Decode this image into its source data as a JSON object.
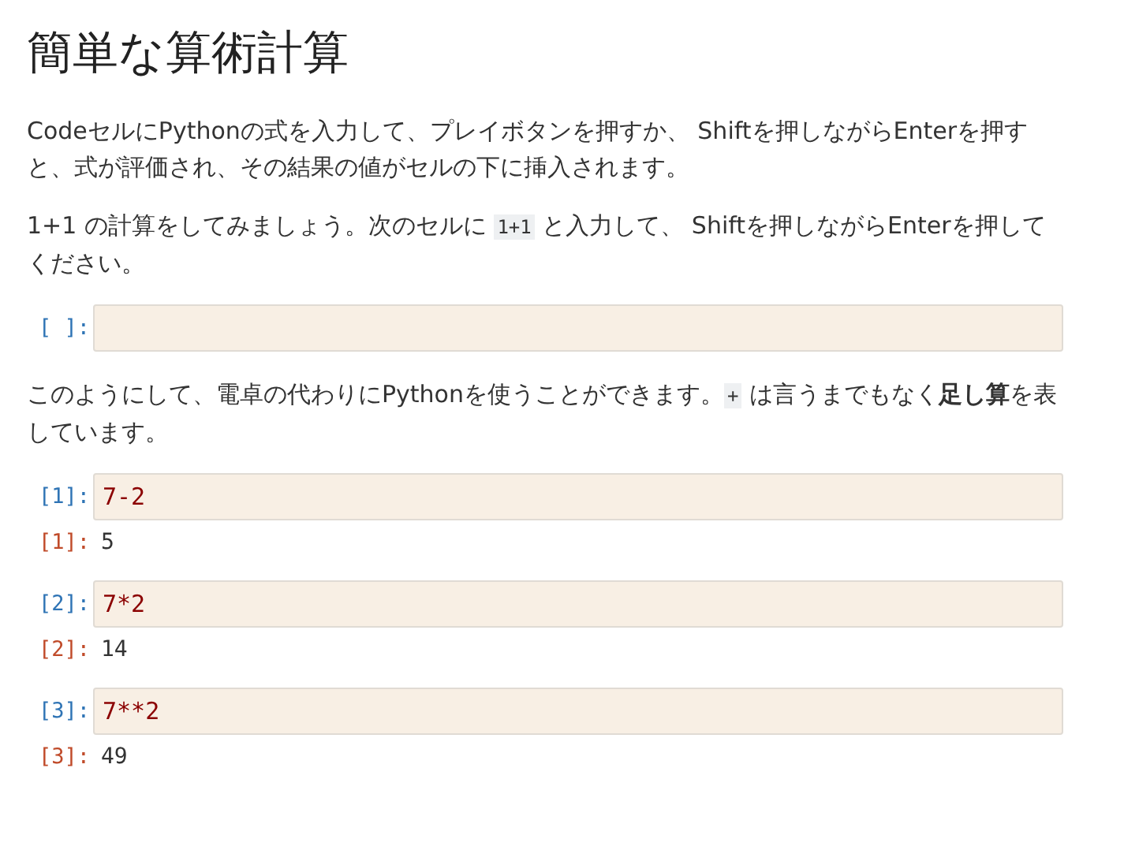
{
  "title": "簡単な算術計算",
  "blocks": [
    {
      "kind": "paragraph",
      "parts": [
        {
          "kind": "text",
          "text": "CodeセルにPythonの式を入力して、プレイボタンを押すか、 Shiftを押しながらEnterを押すと、式が評価され、その結果の値がセルの下に挿入されます。"
        }
      ]
    },
    {
      "kind": "paragraph",
      "parts": [
        {
          "kind": "text",
          "text": "1+1 の計算をしてみましょう。次のセルに "
        },
        {
          "kind": "code",
          "text": "1+1"
        },
        {
          "kind": "text",
          "text": " と入力して、 Shiftを押しながらEnterを押してください。"
        }
      ]
    },
    {
      "kind": "cell",
      "input_prompt": "[ ]:"
    },
    {
      "kind": "paragraph",
      "parts": [
        {
          "kind": "text",
          "text": "このようにして、電卓の代わりにPythonを使うことができます。"
        },
        {
          "kind": "code",
          "text": "+"
        },
        {
          "kind": "text",
          "text": " は言うまでもなく**足し算**を表しています。"
        }
      ]
    },
    {
      "kind": "cell",
      "input_prompt": "[1]:",
      "code": "7-2",
      "output_prompt": "[1]:",
      "output": "5"
    },
    {
      "kind": "cell",
      "input_prompt": "[2]:",
      "code": "7*2",
      "output_prompt": "[2]:",
      "output": "14"
    },
    {
      "kind": "cell",
      "input_prompt": "[3]:",
      "code": "7**2",
      "output_prompt": "[3]:",
      "output": "49"
    }
  ]
}
